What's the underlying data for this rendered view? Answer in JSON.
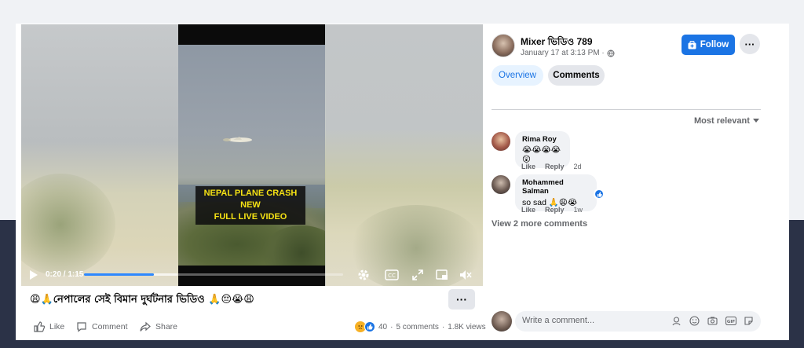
{
  "video": {
    "overlay_caption_line1": "NEPAL PLANE CRASH NEW",
    "overlay_caption_line2": "FULL LIVE VIDEO",
    "time": "0:20 / 1:15",
    "progress": 0.27,
    "buffered": 0.36,
    "accent_color": "#2d88ff"
  },
  "post": {
    "title": "😩🙏নেপালের সেই বিমান দুর্ঘটনার ভিডিও 🙏😔😭😩",
    "more_label": "···",
    "actions": {
      "like": "Like",
      "comment": "Comment",
      "share": "Share"
    },
    "stats": {
      "reactions": "40",
      "comments": "5 comments",
      "views": "1.8K views",
      "separator": "·"
    }
  },
  "author": {
    "name": "Mixer ভিডিও 789",
    "date": "January 17 at 3:13 PM ·",
    "follow_label": "Follow",
    "dots_label": "···"
  },
  "tabs": [
    {
      "label": "Overview"
    },
    {
      "label": "Comments"
    }
  ],
  "sort_label": "Most relevant",
  "comments": [
    {
      "name": "Rima Roy",
      "text": "😭😭😭😭 😲",
      "like": "Like",
      "reply": "Reply",
      "time": "2d"
    },
    {
      "name": "Mohammed Salman",
      "text": "so sad 🙏😩😭",
      "like": "Like",
      "reply": "Reply",
      "time": "1w"
    }
  ],
  "view_more": "View 2 more comments",
  "composer": {
    "placeholder": "Write a comment..."
  },
  "colors": {
    "brand_blue": "#1b74e4",
    "tab_bg": "#e7f3ff",
    "dark_band": "#2b3247"
  }
}
